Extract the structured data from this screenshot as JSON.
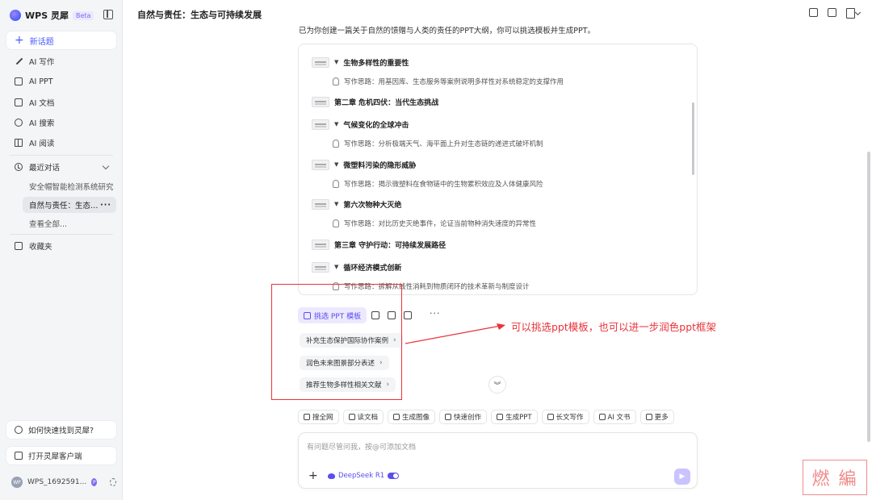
{
  "sidebar": {
    "brand": "WPS 灵犀",
    "beta": "Beta",
    "new_topic": "新话题",
    "nav": [
      {
        "label": "AI 写作",
        "icon": "pen-icon"
      },
      {
        "label": "AI PPT",
        "icon": "ppt-icon"
      },
      {
        "label": "AI 文档",
        "icon": "doc-icon"
      },
      {
        "label": "AI 搜索",
        "icon": "search-icon"
      },
      {
        "label": "AI 阅读",
        "icon": "book-icon"
      }
    ],
    "recent_label": "最近对话",
    "recent": [
      {
        "label": "安全帽智能检测系统研究"
      },
      {
        "label": "自然与责任：生态…",
        "active": true
      },
      {
        "label": "查看全部..."
      }
    ],
    "favorites": "收藏夹",
    "help": "如何快速找到灵犀?",
    "open_client": "打开灵犀客户端",
    "user": {
      "avatar": "WP",
      "name": "WPS_1692591...",
      "badge": "P"
    }
  },
  "main": {
    "title": "自然与责任：生态与可持续发展",
    "intro": "已为你创建一篇关于自然的馈赠与人类的责任的PPT大纲，你可以挑选模板并生成PPT。",
    "outline": [
      {
        "kind": "section",
        "text": "生物多样性的重要性"
      },
      {
        "kind": "hint",
        "text": "写作思路：用基因库、生态服务等案例说明多样性对系统稳定的支撑作用"
      },
      {
        "kind": "chapter",
        "text": "第二章 危机四伏：当代生态挑战"
      },
      {
        "kind": "section",
        "text": "气候变化的全球冲击"
      },
      {
        "kind": "hint",
        "text": "写作思路：分析极端天气、海平面上升对生态链的递进式破坏机制"
      },
      {
        "kind": "section",
        "text": "微塑料污染的隐形威胁"
      },
      {
        "kind": "hint",
        "text": "写作思路：揭示微塑料在食物链中的生物累积效应及人体健康风险"
      },
      {
        "kind": "section",
        "text": "第六次物种大灭绝"
      },
      {
        "kind": "hint",
        "text": "写作思路：对比历史灭绝事件，论证当前物种消失速度的异常性"
      },
      {
        "kind": "chapter",
        "text": "第三章 守护行动：可持续发展路径"
      },
      {
        "kind": "section",
        "text": "循环经济模式创新"
      },
      {
        "kind": "hint",
        "text": "写作思路：拆解从线性消耗到物质闭环的技术革新与制度设计"
      }
    ],
    "pick_template": "挑选 PPT 模板",
    "more": "···",
    "suggestions": [
      {
        "label": "补充生态保护国际协作案例",
        "arrow": "›"
      },
      {
        "label": "润色未来图景部分表述",
        "arrow": "›"
      },
      {
        "label": "推荐生物多样性相关文献",
        "arrow": "›"
      }
    ],
    "annotation": "可以挑选ppt模板，也可以进一步润色ppt框架",
    "scroll_down": "︾",
    "tools": [
      {
        "label": "搜全网"
      },
      {
        "label": "读文档"
      },
      {
        "label": "生成图像"
      },
      {
        "label": "快速创作"
      },
      {
        "label": "生成PPT"
      },
      {
        "label": "长文写作"
      },
      {
        "label": "AI 文书"
      },
      {
        "label": "更多"
      }
    ],
    "input_placeholder": "有问题尽管问我，按@可添加文档",
    "plus": "+",
    "model": "DeepSeek R1",
    "send": "▶"
  },
  "watermark": "燃 編",
  "colors": {
    "accent": "#5b4df0",
    "annotation": "#e8333a"
  }
}
